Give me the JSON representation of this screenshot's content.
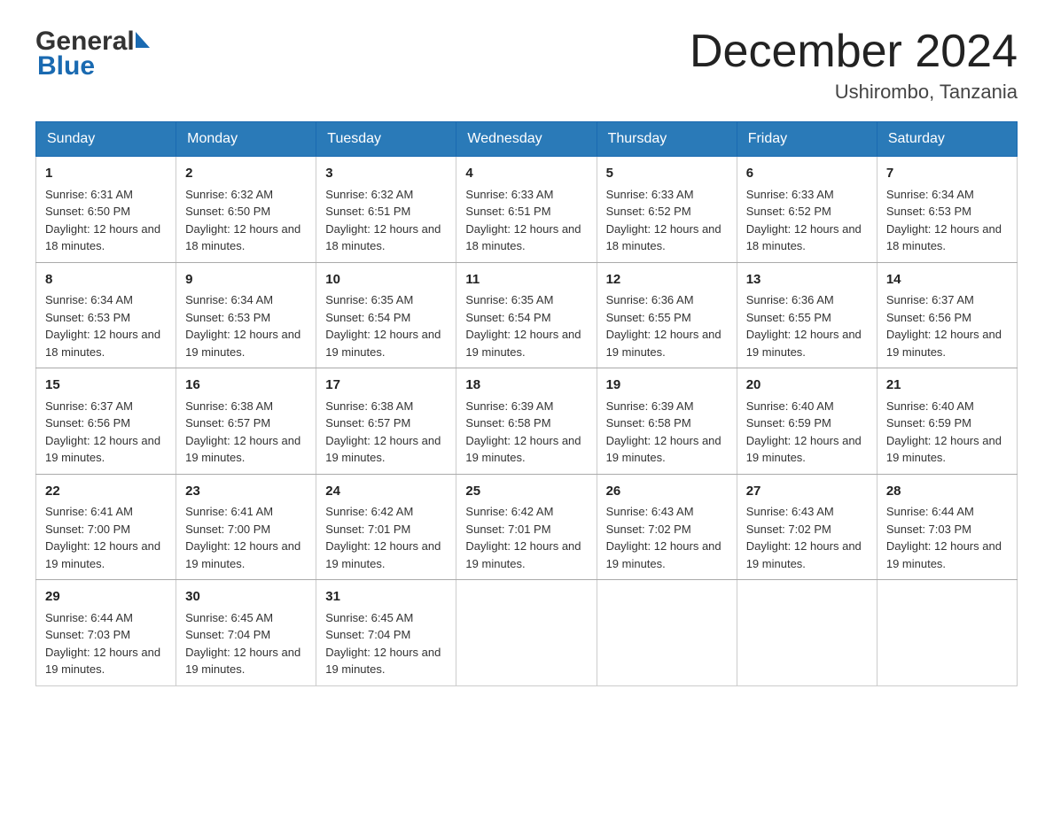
{
  "header": {
    "logo_general": "General",
    "logo_blue": "Blue",
    "month_title": "December 2024",
    "location": "Ushirombo, Tanzania"
  },
  "weekdays": [
    "Sunday",
    "Monday",
    "Tuesday",
    "Wednesday",
    "Thursday",
    "Friday",
    "Saturday"
  ],
  "weeks": [
    [
      {
        "day": "1",
        "sunrise": "6:31 AM",
        "sunset": "6:50 PM",
        "daylight": "12 hours and 18 minutes."
      },
      {
        "day": "2",
        "sunrise": "6:32 AM",
        "sunset": "6:50 PM",
        "daylight": "12 hours and 18 minutes."
      },
      {
        "day": "3",
        "sunrise": "6:32 AM",
        "sunset": "6:51 PM",
        "daylight": "12 hours and 18 minutes."
      },
      {
        "day": "4",
        "sunrise": "6:33 AM",
        "sunset": "6:51 PM",
        "daylight": "12 hours and 18 minutes."
      },
      {
        "day": "5",
        "sunrise": "6:33 AM",
        "sunset": "6:52 PM",
        "daylight": "12 hours and 18 minutes."
      },
      {
        "day": "6",
        "sunrise": "6:33 AM",
        "sunset": "6:52 PM",
        "daylight": "12 hours and 18 minutes."
      },
      {
        "day": "7",
        "sunrise": "6:34 AM",
        "sunset": "6:53 PM",
        "daylight": "12 hours and 18 minutes."
      }
    ],
    [
      {
        "day": "8",
        "sunrise": "6:34 AM",
        "sunset": "6:53 PM",
        "daylight": "12 hours and 18 minutes."
      },
      {
        "day": "9",
        "sunrise": "6:34 AM",
        "sunset": "6:53 PM",
        "daylight": "12 hours and 19 minutes."
      },
      {
        "day": "10",
        "sunrise": "6:35 AM",
        "sunset": "6:54 PM",
        "daylight": "12 hours and 19 minutes."
      },
      {
        "day": "11",
        "sunrise": "6:35 AM",
        "sunset": "6:54 PM",
        "daylight": "12 hours and 19 minutes."
      },
      {
        "day": "12",
        "sunrise": "6:36 AM",
        "sunset": "6:55 PM",
        "daylight": "12 hours and 19 minutes."
      },
      {
        "day": "13",
        "sunrise": "6:36 AM",
        "sunset": "6:55 PM",
        "daylight": "12 hours and 19 minutes."
      },
      {
        "day": "14",
        "sunrise": "6:37 AM",
        "sunset": "6:56 PM",
        "daylight": "12 hours and 19 minutes."
      }
    ],
    [
      {
        "day": "15",
        "sunrise": "6:37 AM",
        "sunset": "6:56 PM",
        "daylight": "12 hours and 19 minutes."
      },
      {
        "day": "16",
        "sunrise": "6:38 AM",
        "sunset": "6:57 PM",
        "daylight": "12 hours and 19 minutes."
      },
      {
        "day": "17",
        "sunrise": "6:38 AM",
        "sunset": "6:57 PM",
        "daylight": "12 hours and 19 minutes."
      },
      {
        "day": "18",
        "sunrise": "6:39 AM",
        "sunset": "6:58 PM",
        "daylight": "12 hours and 19 minutes."
      },
      {
        "day": "19",
        "sunrise": "6:39 AM",
        "sunset": "6:58 PM",
        "daylight": "12 hours and 19 minutes."
      },
      {
        "day": "20",
        "sunrise": "6:40 AM",
        "sunset": "6:59 PM",
        "daylight": "12 hours and 19 minutes."
      },
      {
        "day": "21",
        "sunrise": "6:40 AM",
        "sunset": "6:59 PM",
        "daylight": "12 hours and 19 minutes."
      }
    ],
    [
      {
        "day": "22",
        "sunrise": "6:41 AM",
        "sunset": "7:00 PM",
        "daylight": "12 hours and 19 minutes."
      },
      {
        "day": "23",
        "sunrise": "6:41 AM",
        "sunset": "7:00 PM",
        "daylight": "12 hours and 19 minutes."
      },
      {
        "day": "24",
        "sunrise": "6:42 AM",
        "sunset": "7:01 PM",
        "daylight": "12 hours and 19 minutes."
      },
      {
        "day": "25",
        "sunrise": "6:42 AM",
        "sunset": "7:01 PM",
        "daylight": "12 hours and 19 minutes."
      },
      {
        "day": "26",
        "sunrise": "6:43 AM",
        "sunset": "7:02 PM",
        "daylight": "12 hours and 19 minutes."
      },
      {
        "day": "27",
        "sunrise": "6:43 AM",
        "sunset": "7:02 PM",
        "daylight": "12 hours and 19 minutes."
      },
      {
        "day": "28",
        "sunrise": "6:44 AM",
        "sunset": "7:03 PM",
        "daylight": "12 hours and 19 minutes."
      }
    ],
    [
      {
        "day": "29",
        "sunrise": "6:44 AM",
        "sunset": "7:03 PM",
        "daylight": "12 hours and 19 minutes."
      },
      {
        "day": "30",
        "sunrise": "6:45 AM",
        "sunset": "7:04 PM",
        "daylight": "12 hours and 19 minutes."
      },
      {
        "day": "31",
        "sunrise": "6:45 AM",
        "sunset": "7:04 PM",
        "daylight": "12 hours and 19 minutes."
      },
      null,
      null,
      null,
      null
    ]
  ],
  "labels": {
    "sunrise": "Sunrise:",
    "sunset": "Sunset:",
    "daylight": "Daylight:"
  }
}
